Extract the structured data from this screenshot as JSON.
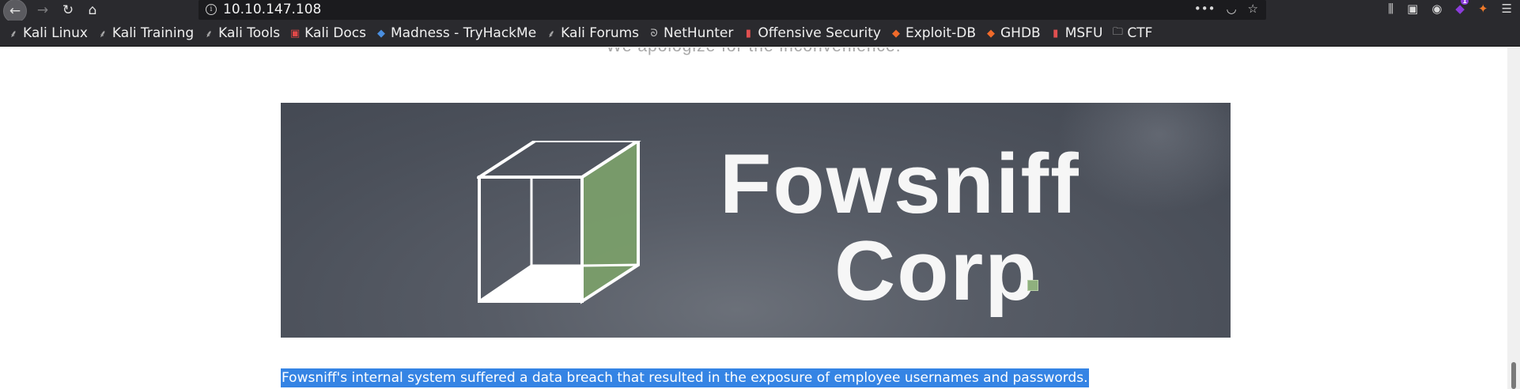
{
  "browser": {
    "url": "10.10.147.108",
    "bookmarks": [
      {
        "label": "Kali Linux",
        "icon": "kali-dragon-icon"
      },
      {
        "label": "Kali Training",
        "icon": "kali-dragon-icon"
      },
      {
        "label": "Kali Tools",
        "icon": "kali-dragon-icon"
      },
      {
        "label": "Kali Docs",
        "icon": "kali-docs-icon"
      },
      {
        "label": "Madness - TryHackMe",
        "icon": "tryhackme-icon"
      },
      {
        "label": "Kali Forums",
        "icon": "kali-dragon-icon"
      },
      {
        "label": "NetHunter",
        "icon": "nethunter-icon"
      },
      {
        "label": "Offensive Security",
        "icon": "offsec-icon"
      },
      {
        "label": "Exploit-DB",
        "icon": "exploitdb-icon"
      },
      {
        "label": "GHDB",
        "icon": "exploitdb-icon"
      },
      {
        "label": "MSFU",
        "icon": "offsec-icon"
      },
      {
        "label": "CTF",
        "icon": "folder-icon"
      }
    ],
    "extension_badge": "1"
  },
  "page": {
    "apology": "We apologize for the inconvenience.",
    "banner": {
      "brand_line_1": "Fowsniff",
      "brand_line_2": "Corp",
      "accent_color": "#8fb07e"
    },
    "selected_text": "Fowsniff's internal system suffered a data breach that resulted in the exposure of employee usernames and passwords."
  }
}
